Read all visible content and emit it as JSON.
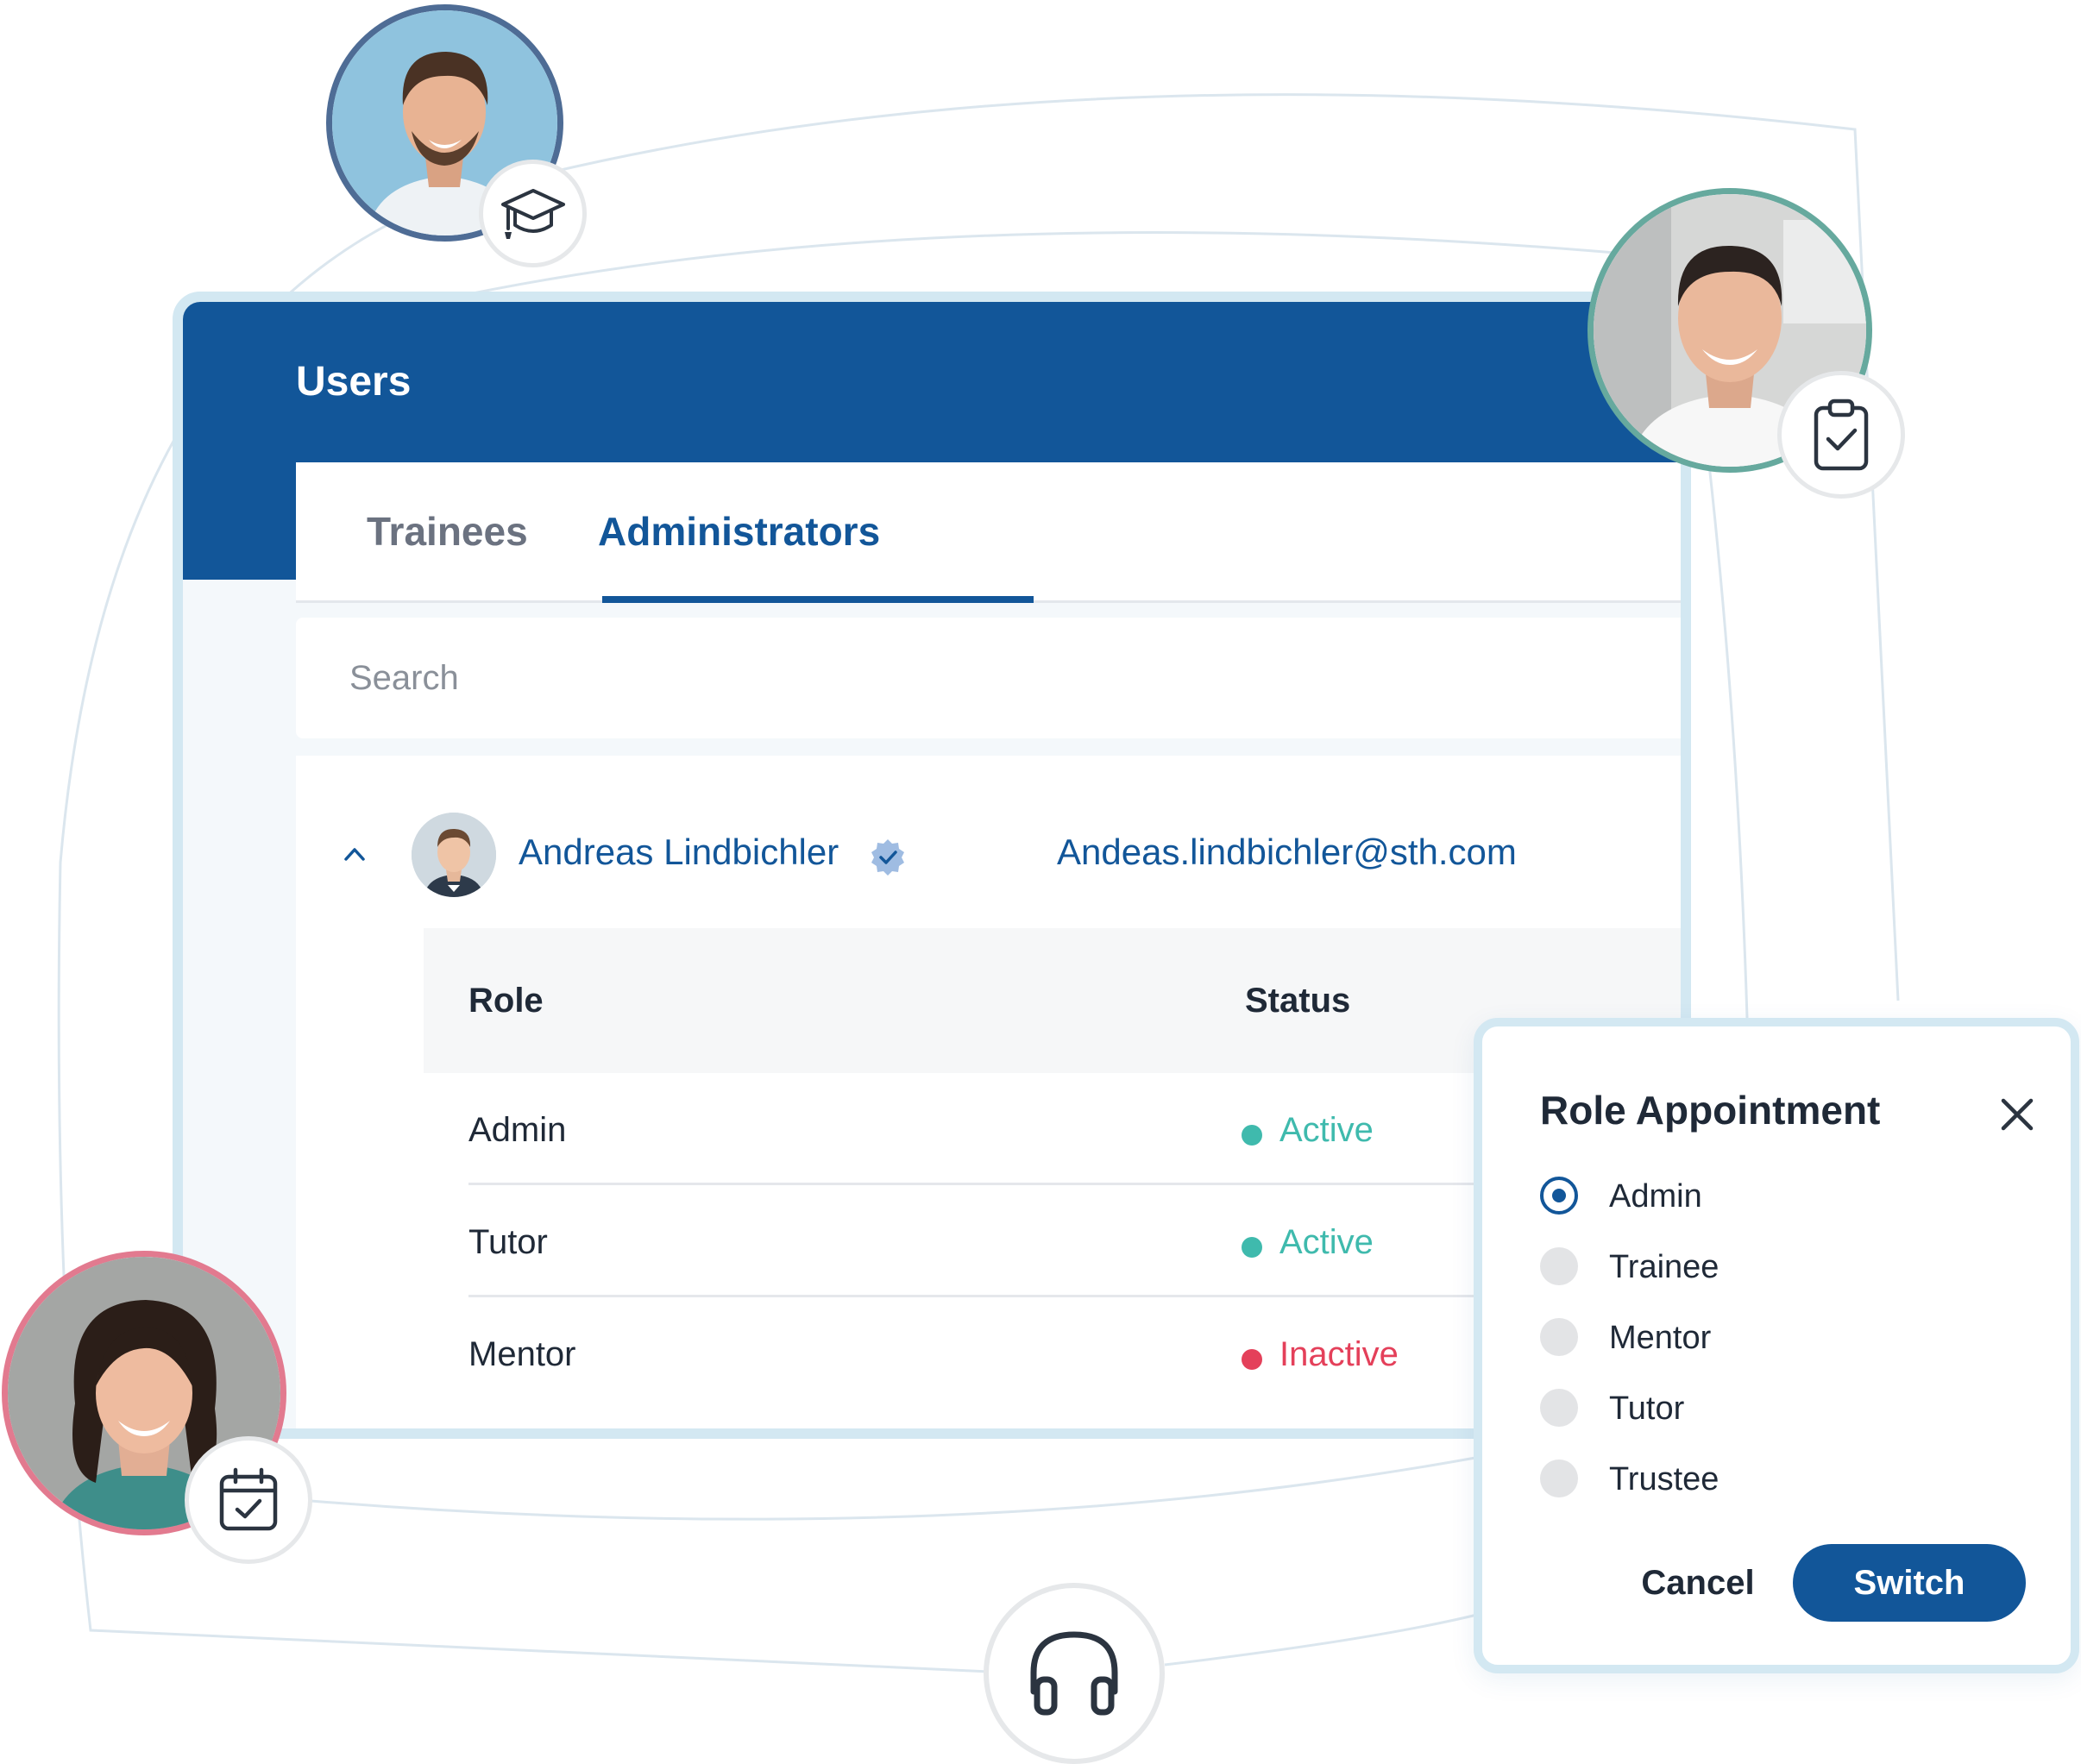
{
  "window": {
    "title": "Users"
  },
  "tabs": [
    {
      "label": "Trainees",
      "active": false
    },
    {
      "label": "Administrators",
      "active": true
    }
  ],
  "search": {
    "placeholder": "Search",
    "value": ""
  },
  "user": {
    "name": "Andreas Lindbichler",
    "email": "Andeas.lindbichler@sth.com",
    "verified": true,
    "expanded": true
  },
  "roles_table": {
    "headers": {
      "role": "Role",
      "status": "Status"
    },
    "rows": [
      {
        "role": "Admin",
        "status": "Active",
        "status_color": "#3fbaad"
      },
      {
        "role": "Tutor",
        "status": "Active",
        "status_color": "#3fbaad"
      },
      {
        "role": "Mentor",
        "status": "Inactive",
        "status_color": "#e4405a"
      }
    ]
  },
  "popup": {
    "title": "Role Appointment",
    "options": [
      {
        "label": "Admin",
        "selected": true
      },
      {
        "label": "Trainee",
        "selected": false
      },
      {
        "label": "Mentor",
        "selected": false
      },
      {
        "label": "Tutor",
        "selected": false
      },
      {
        "label": "Trustee",
        "selected": false
      }
    ],
    "cancel_label": "Cancel",
    "switch_label": "Switch"
  },
  "floating_avatars": [
    {
      "ring_color": "#4e6c95",
      "badge_icon": "graduation-cap-icon"
    },
    {
      "ring_color": "#66a99e",
      "badge_icon": "clipboard-check-icon"
    },
    {
      "ring_color": "#e27a8f",
      "badge_icon": "calendar-check-icon"
    }
  ],
  "support": {
    "icon": "headphones-icon"
  },
  "colors": {
    "primary": "#125699",
    "frame": "#d3e8f2",
    "active": "#3fbaad",
    "inactive": "#e4405a"
  }
}
